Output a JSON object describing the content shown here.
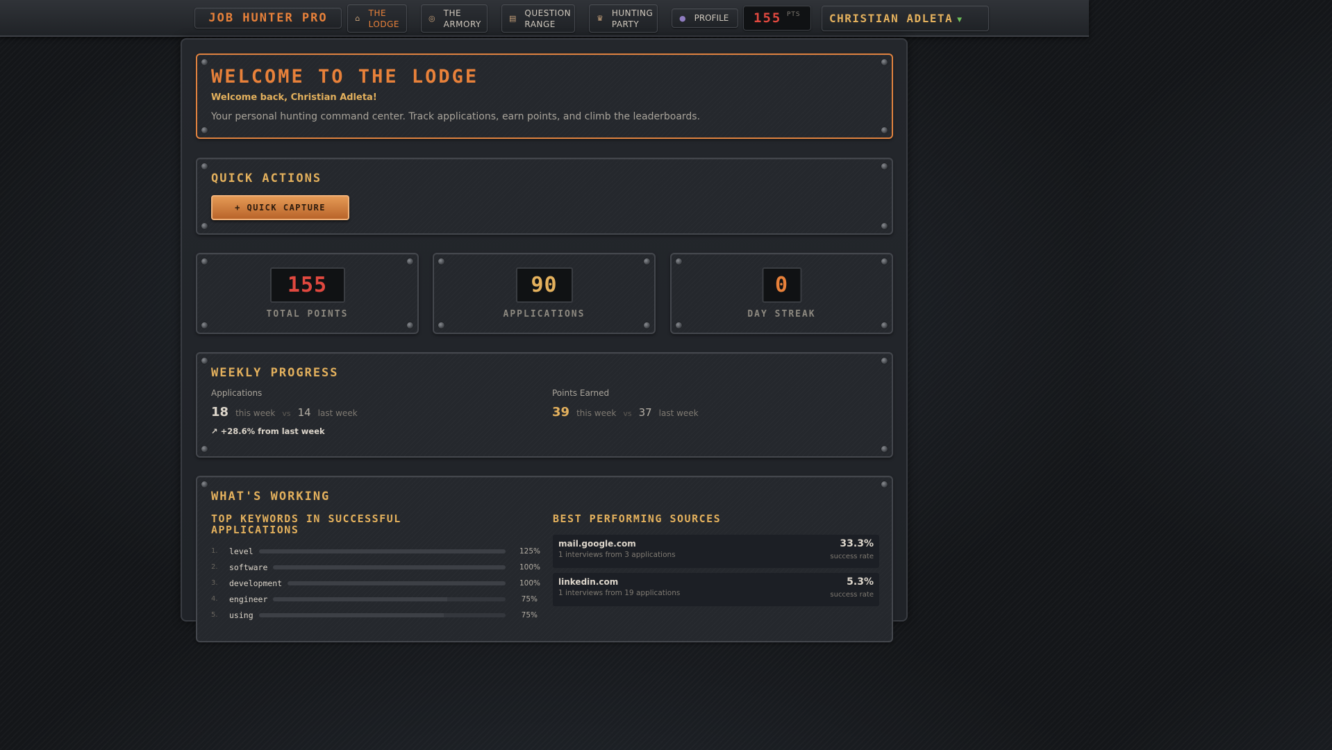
{
  "nav": {
    "brand": "JOB HUNTER PRO",
    "items": [
      {
        "icon": "house-icon",
        "glyph": "⌂",
        "line1": "THE",
        "line2": "LODGE",
        "active": true
      },
      {
        "icon": "target-icon",
        "glyph": "◎",
        "line1": "THE",
        "line2": "ARMORY",
        "active": false
      },
      {
        "icon": "clipboard-icon",
        "glyph": "▤",
        "line1": "QUESTION",
        "line2": "RANGE",
        "active": false
      },
      {
        "icon": "trophy-icon",
        "glyph": "♛",
        "line1": "HUNTING",
        "line2": "PARTY",
        "active": false
      }
    ],
    "profile": {
      "icon": "user-icon",
      "glyph": "●",
      "label": "PROFILE"
    },
    "points": {
      "value": "155",
      "unit": "PTS"
    },
    "user": {
      "name": "CHRISTIAN ADLETA",
      "caret": "▼"
    }
  },
  "welcome": {
    "title": "WELCOME TO THE LODGE",
    "subtitle": "Welcome back, Christian Adleta!",
    "description": "Your personal hunting command center. Track applications, earn points, and climb the leaderboards."
  },
  "quick_actions": {
    "title": "QUICK ACTIONS",
    "button": "+ QUICK CAPTURE"
  },
  "stats": [
    {
      "value": "155",
      "label": "TOTAL POINTS"
    },
    {
      "value": "90",
      "label": "APPLICATIONS"
    },
    {
      "value": "0",
      "label": "DAY STREAK"
    }
  ],
  "weekly": {
    "title": "WEEKLY PROGRESS",
    "applications": {
      "heading": "Applications",
      "this_week": "18",
      "this_label": "this week",
      "vs": "vs",
      "last_week": "14",
      "last_label": "last week",
      "delta": "↗ +28.6% from last week"
    },
    "points": {
      "heading": "Points Earned",
      "this_week": "39",
      "this_label": "this week",
      "vs": "vs",
      "last_week": "37",
      "last_label": "last week"
    }
  },
  "working": {
    "title": "WHAT'S WORKING",
    "keywords_title": "TOP KEYWORDS IN SUCCESSFUL APPLICATIONS",
    "keywords": [
      {
        "idx": "1.",
        "word": "level",
        "pct": "125%",
        "fill": 1.0
      },
      {
        "idx": "2.",
        "word": "software",
        "pct": "100%",
        "fill": 1.0
      },
      {
        "idx": "3.",
        "word": "development",
        "pct": "100%",
        "fill": 1.0
      },
      {
        "idx": "4.",
        "word": "engineer",
        "pct": "75%",
        "fill": 0.75
      },
      {
        "idx": "5.",
        "word": "using",
        "pct": "75%",
        "fill": 0.75
      }
    ],
    "sources_title": "BEST PERFORMING SOURCES",
    "sources": [
      {
        "host": "mail.google.com",
        "meta": "1 interviews from 3 applications",
        "rate": "33.3%",
        "rate_label": "success rate"
      },
      {
        "host": "linkedin.com",
        "meta": "1 interviews from 19 applications",
        "rate": "5.3%",
        "rate_label": "success rate"
      }
    ]
  },
  "colors": {
    "accent_orange": "#e8813a",
    "accent_gold": "#e4b15d",
    "digit_red": "#e0483f",
    "background": "#16191e"
  }
}
